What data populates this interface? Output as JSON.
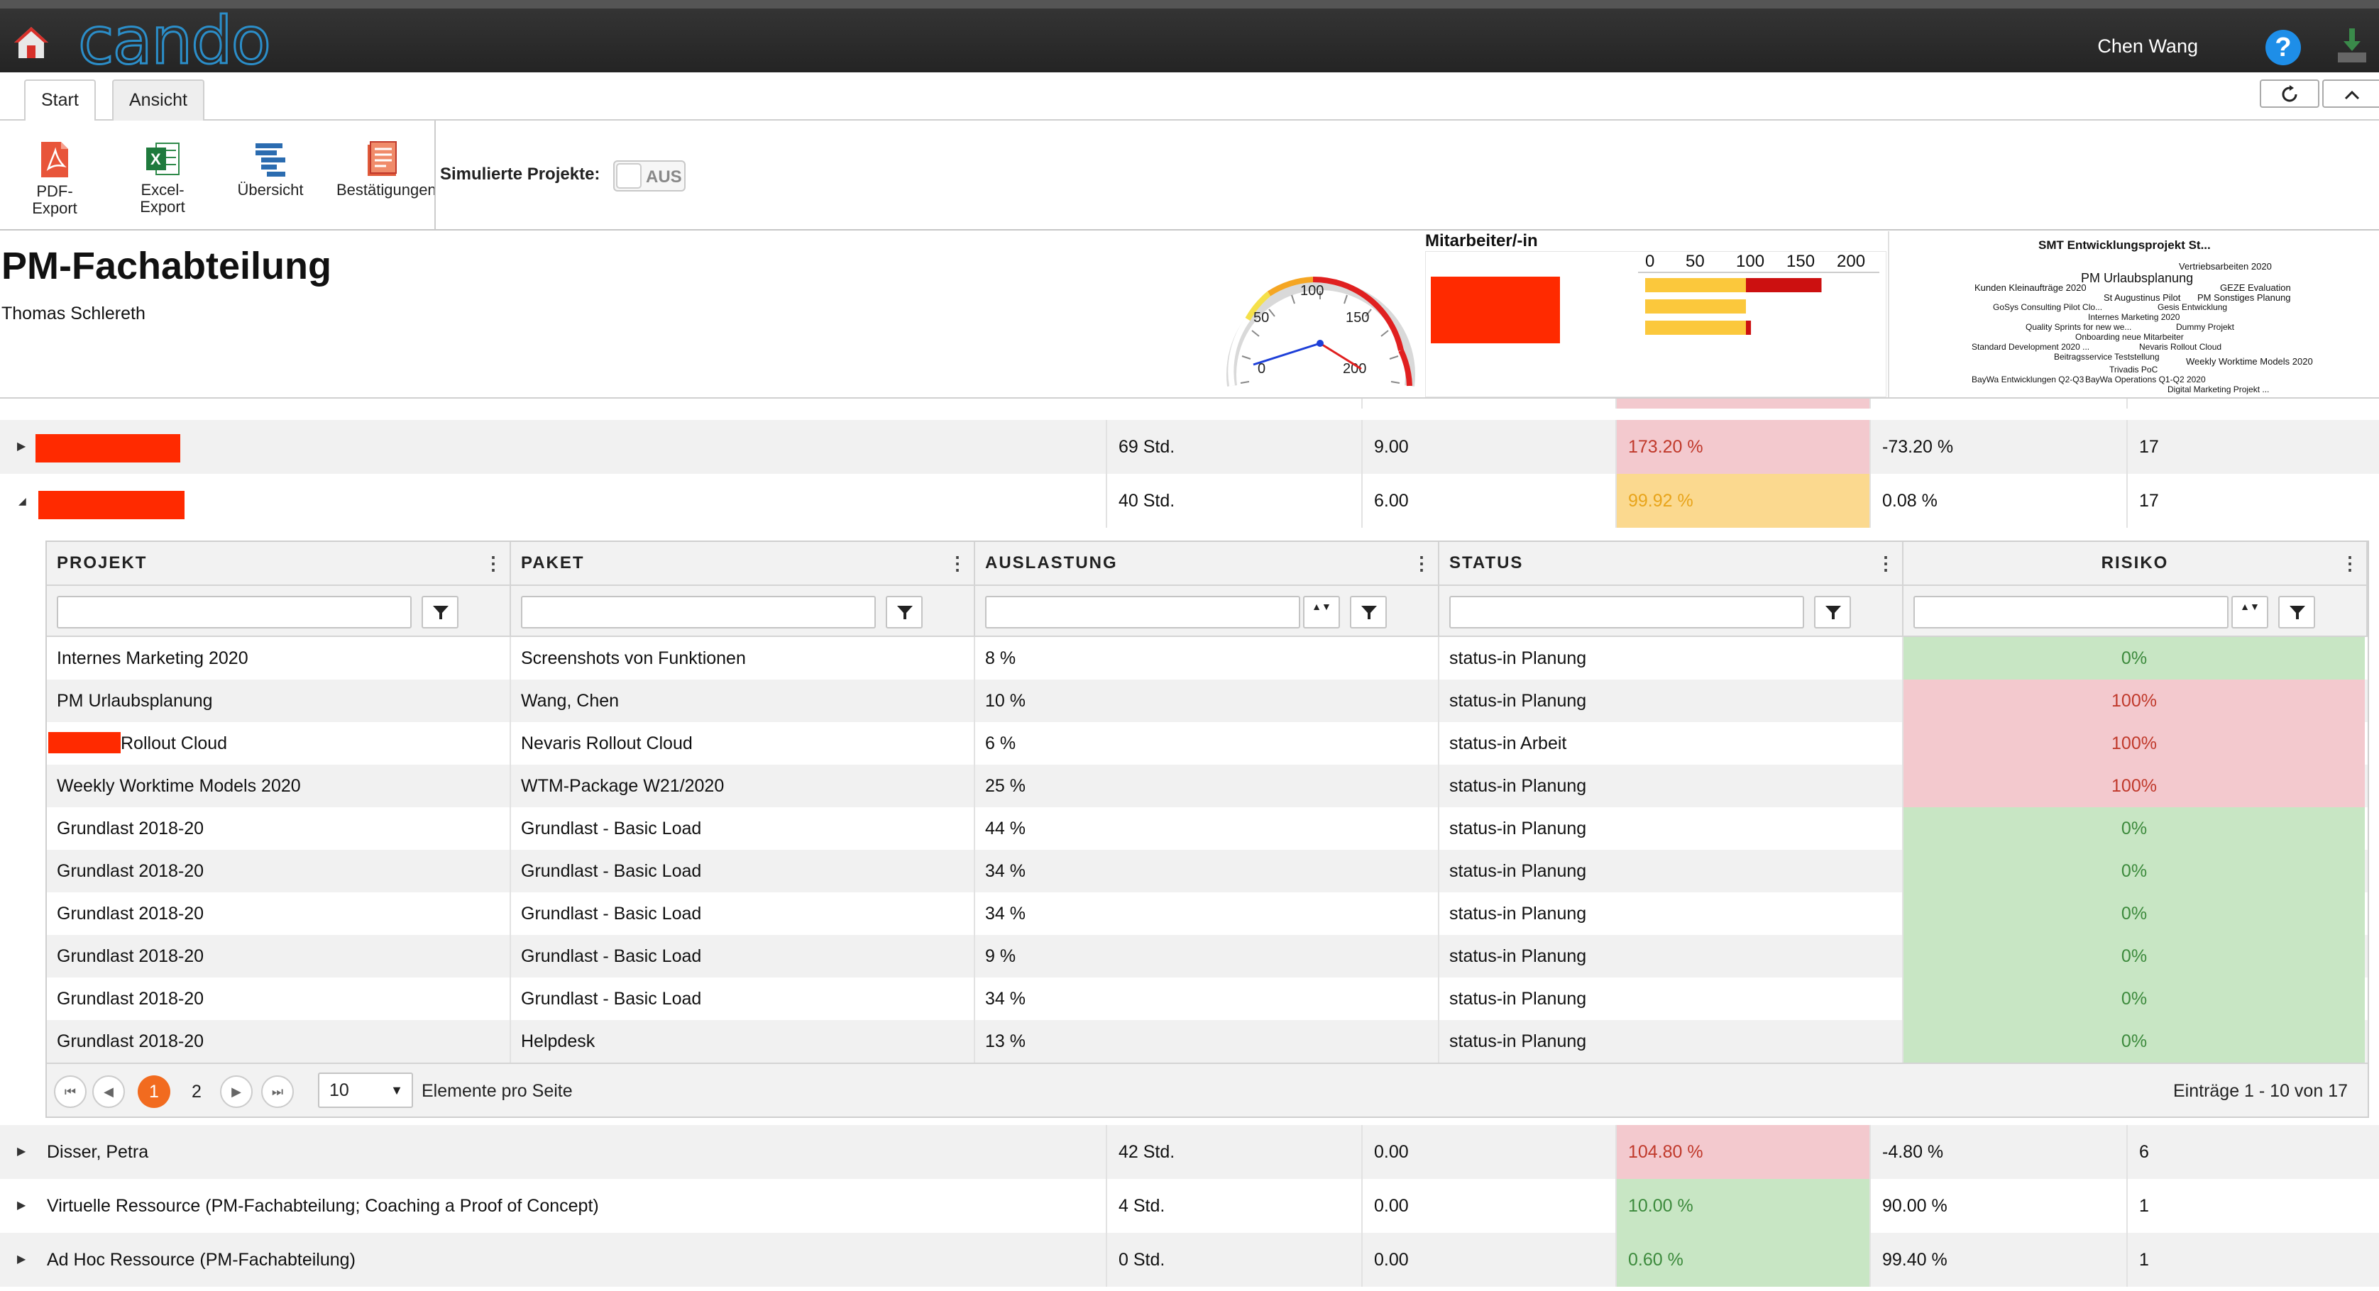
{
  "app": {
    "logo": "cando",
    "user": "Chen Wang",
    "help_label": "?"
  },
  "tabs": [
    {
      "label": "Start",
      "active": true
    },
    {
      "label": "Ansicht",
      "active": false
    }
  ],
  "ribbon": {
    "pdf_label_1": "PDF-",
    "pdf_label_2": "Export",
    "excel_label_1": "Excel-",
    "excel_label_2": "Export",
    "overview_label": "Übersicht",
    "confirm_label": "Bestätigungen",
    "sim_label": "Simulierte Projekte:",
    "sim_toggle": "AUS"
  },
  "header": {
    "title": "PM-Fachabteilung",
    "subtitle": "Thomas Schlereth"
  },
  "gauge": {
    "ticks": [
      "0",
      "50",
      "100",
      "150",
      "200"
    ],
    "value": 100,
    "max": 200
  },
  "mitarbeiter_chart": {
    "label": "Mitarbeiter/-in",
    "axis": [
      "0",
      "50",
      "100",
      "150",
      "200"
    ],
    "bars": [
      {
        "yellow": 100,
        "red": 75
      },
      {
        "yellow": 100,
        "red": 0
      },
      {
        "yellow": 100,
        "red": 5
      }
    ]
  },
  "wordcloud": {
    "words": [
      "SMT Entwicklungsprojekt St...",
      "Vertriebsarbeiten 2020",
      "PM Urlaubsplanung",
      "Kunden Kleinaufträge 2020",
      "GEZE Evaluation",
      "St Augustinus Pilot",
      "PM Sonstiges Planung",
      "GoSys Consulting Pilot Clo...",
      "Gesis Entwicklung",
      "Internes Marketing 2020",
      "Quality Sprints for new we...",
      "Dummy Projekt",
      "Onboarding neue Mitarbeiter",
      "Standard Development 2020 ...",
      "Nevaris Rollout Cloud",
      "Beitragsservice Teststellung",
      "Weekly Worktime Models 2020",
      "Trivadis PoC",
      "BayWa Entwicklungen Q2-Q3",
      "BayWa Operations Q1-Q2 2020",
      "Digital Marketing Projekt ..."
    ]
  },
  "outer_rows": [
    {
      "name": "",
      "hours": "69 Std.",
      "value": "9.00",
      "load": "173.20 %",
      "diff": "-73.20 %",
      "count": "17",
      "load_status": "red",
      "expanded": false
    },
    {
      "name": "",
      "hours": "40 Std.",
      "value": "6.00",
      "load": "99.92 %",
      "diff": "0.08 %",
      "count": "17",
      "load_status": "yellow",
      "expanded": true
    },
    {
      "name": "Disser, Petra",
      "hours": "42 Std.",
      "value": "0.00",
      "load": "104.80 %",
      "diff": "-4.80 %",
      "count": "6",
      "load_status": "red",
      "expanded": false
    },
    {
      "name": "Virtuelle Ressource (PM-Fachabteilung; Coaching a Proof of Concept)",
      "hours": "4 Std.",
      "value": "0.00",
      "load": "10.00 %",
      "diff": "90.00 %",
      "count": "1",
      "load_status": "green",
      "expanded": false
    },
    {
      "name": "Ad Hoc Ressource (PM-Fachabteilung)",
      "hours": "0 Std.",
      "value": "0.00",
      "load": "0.60 %",
      "diff": "99.40 %",
      "count": "1",
      "load_status": "green",
      "expanded": false
    }
  ],
  "detail": {
    "columns": [
      "PROJEKT",
      "PAKET",
      "AUSLASTUNG",
      "STATUS",
      "RISIKO"
    ],
    "rows": [
      {
        "projekt": "Internes Marketing 2020",
        "paket": "Screenshots von Funktionen",
        "auslastung": "8 %",
        "status": "status-in Planung",
        "risiko": "0%",
        "risk": "green"
      },
      {
        "projekt": "PM Urlaubsplanung",
        "paket": "Wang, Chen",
        "auslastung": "10 %",
        "status": "status-in Planung",
        "risiko": "100%",
        "risk": "red"
      },
      {
        "projekt": "Rollout Cloud",
        "paket": "Nevaris Rollout Cloud",
        "auslastung": "6 %",
        "status": "status-in Arbeit",
        "risiko": "100%",
        "risk": "red"
      },
      {
        "projekt": "Weekly Worktime Models 2020",
        "paket": "WTM-Package W21/2020",
        "auslastung": "25 %",
        "status": "status-in Planung",
        "risiko": "100%",
        "risk": "red"
      },
      {
        "projekt": "Grundlast 2018-20",
        "paket": "Grundlast - Basic Load",
        "auslastung": "44 %",
        "status": "status-in Planung",
        "risiko": "0%",
        "risk": "green"
      },
      {
        "projekt": "Grundlast 2018-20",
        "paket": "Grundlast - Basic Load",
        "auslastung": "34 %",
        "status": "status-in Planung",
        "risiko": "0%",
        "risk": "green"
      },
      {
        "projekt": "Grundlast 2018-20",
        "paket": "Grundlast - Basic Load",
        "auslastung": "34 %",
        "status": "status-in Planung",
        "risiko": "0%",
        "risk": "green"
      },
      {
        "projekt": "Grundlast 2018-20",
        "paket": "Grundlast - Basic Load",
        "auslastung": "9 %",
        "status": "status-in Planung",
        "risiko": "0%",
        "risk": "green"
      },
      {
        "projekt": "Grundlast 2018-20",
        "paket": "Grundlast - Basic Load",
        "auslastung": "34 %",
        "status": "status-in Planung",
        "risiko": "0%",
        "risk": "green"
      },
      {
        "projekt": "Grundlast 2018-20",
        "paket": "Helpdesk",
        "auslastung": "13 %",
        "status": "status-in Planung",
        "risiko": "0%",
        "risk": "green"
      }
    ],
    "pager": {
      "pages": [
        "1",
        "2"
      ],
      "current": "1",
      "page_size": "10",
      "page_size_label": "Elemente pro Seite",
      "info": "Einträge 1 - 10 von 17"
    }
  },
  "colors": {
    "red_cell": "#f3c9ce",
    "yellow_cell": "#fbd98f",
    "green_cell": "#c8e6c4",
    "accent": "#f26b1f",
    "redacted": "#ff2a00"
  }
}
